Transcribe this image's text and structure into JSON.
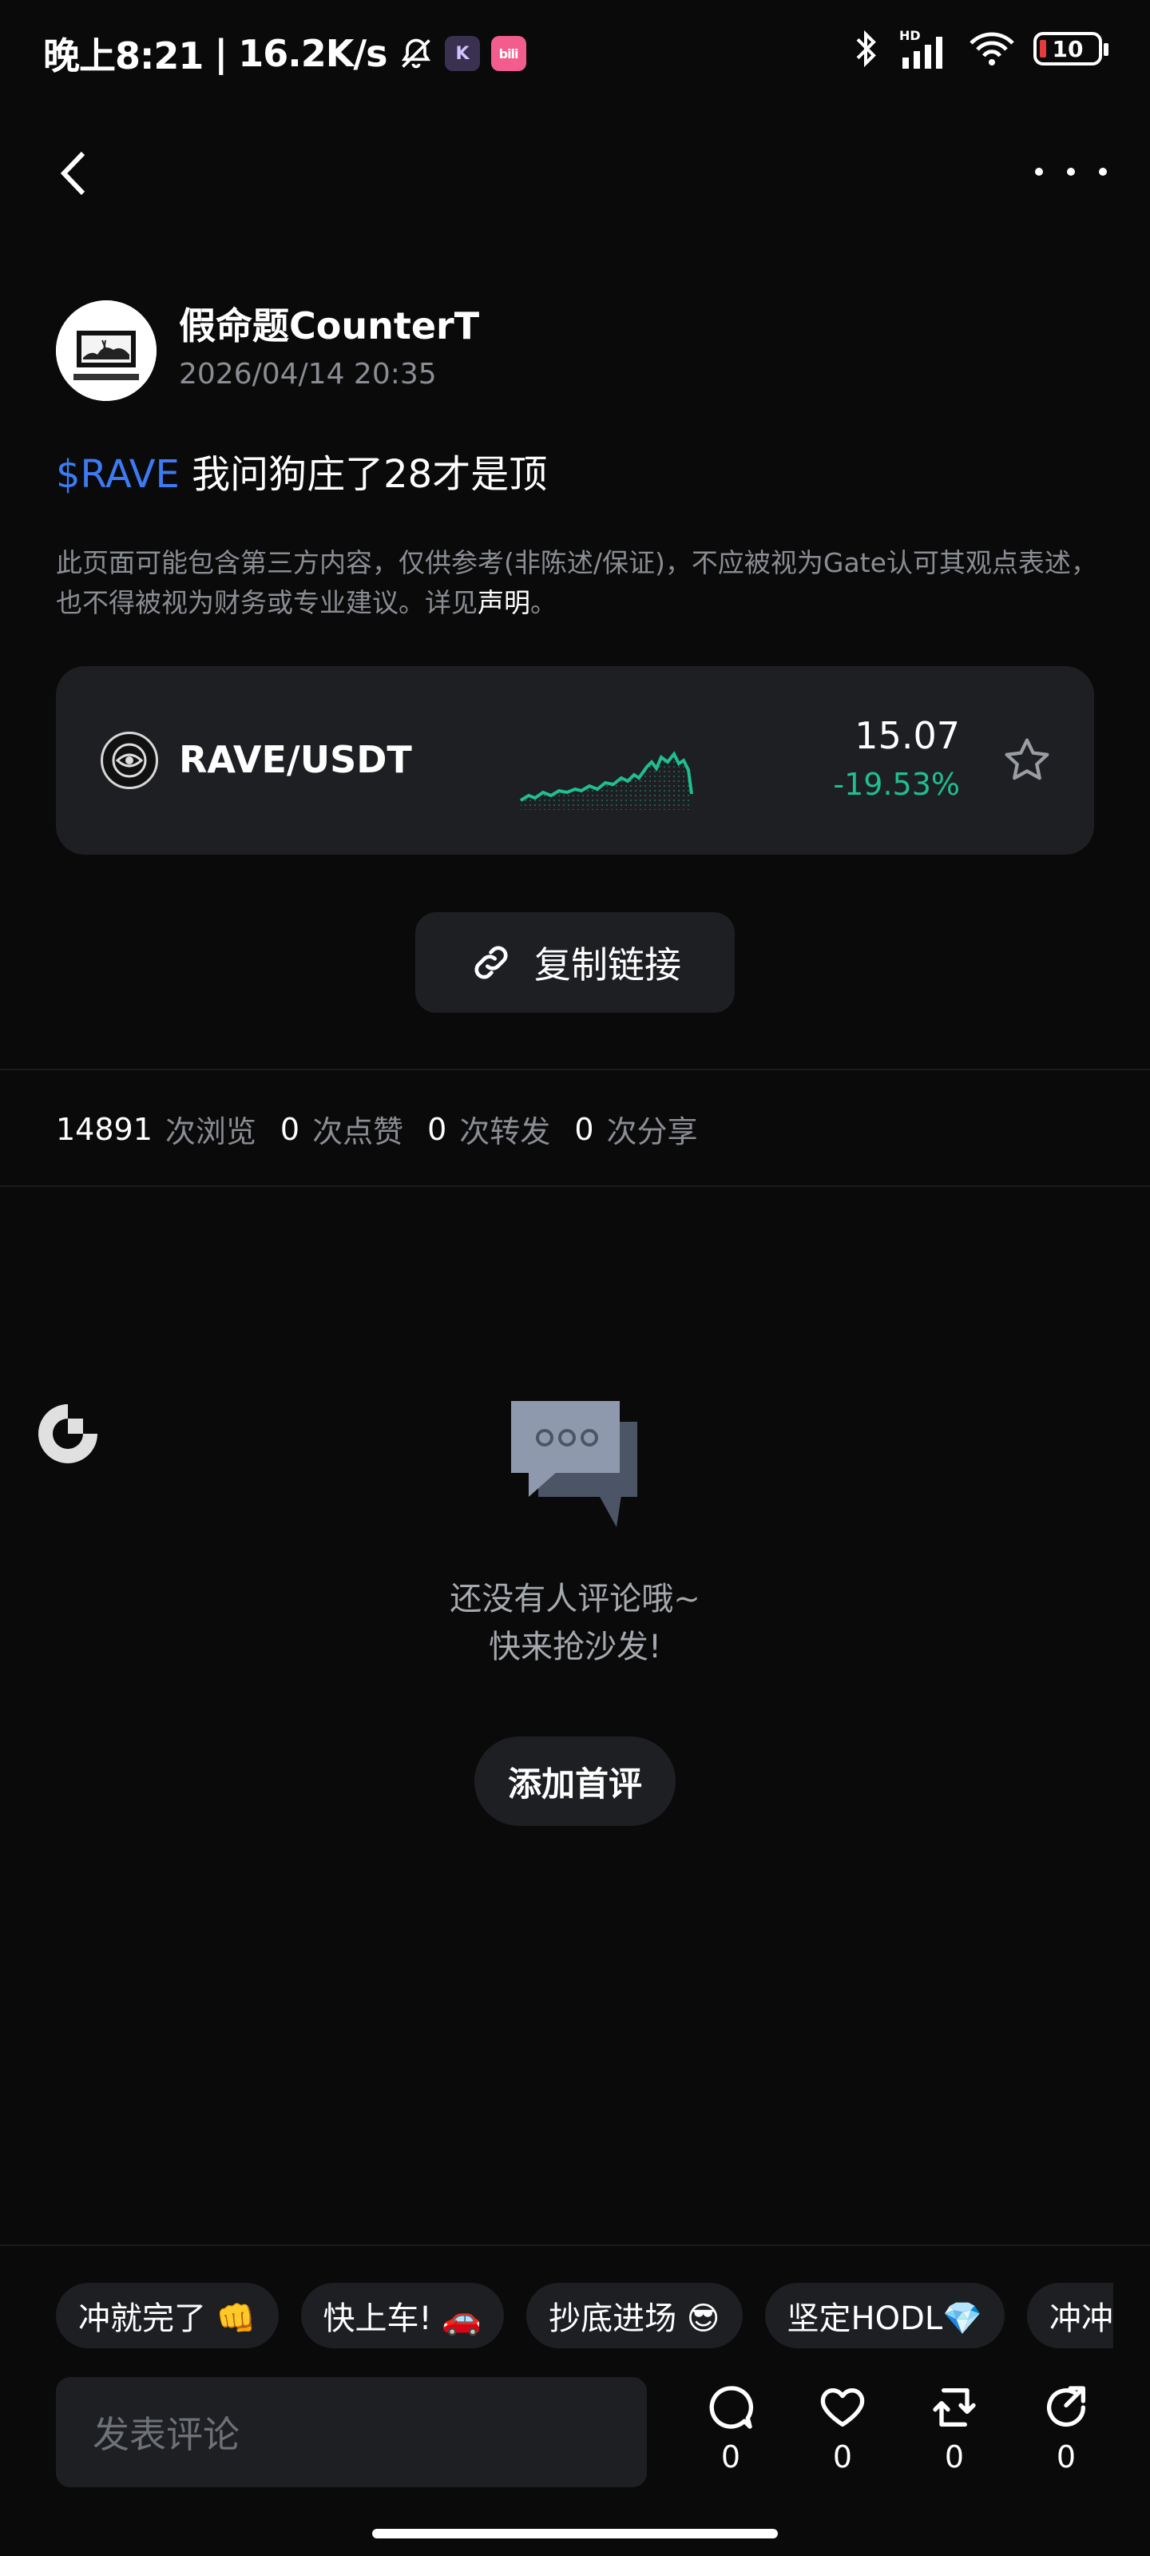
{
  "status_bar": {
    "time": "晚上8:21",
    "separator": "|",
    "speed": "16.2K/s",
    "app_badge_1": "K",
    "app_badge_2": "bili",
    "battery": "10"
  },
  "post": {
    "author": "假命题CounterT",
    "time": "2026/04/14 20:35",
    "tag": "$RAVE",
    "text": "我问狗庄了28才是顶",
    "disclaimer_text": "此页面可能包含第三方内容，仅供参考(非陈述/保证)，不应被视为Gate认可其观点表述，也不得被视为财务或专业建议。详见",
    "disclaimer_link": "声明",
    "disclaimer_end": "。"
  },
  "ticker": {
    "pair": "RAVE/USDT",
    "price": "15.07",
    "change": "-19.53%",
    "up_color": "#1fbf8f"
  },
  "copy_link_label": "复制链接",
  "stats": {
    "views": "14891",
    "views_label": "次浏览",
    "likes": "0",
    "likes_label": "次点赞",
    "reposts": "0",
    "reposts_label": "次转发",
    "shares": "0",
    "shares_label": "次分享"
  },
  "empty_state": {
    "line1": "还没有人评论哦~",
    "line2": "快来抢沙发!",
    "button": "添加首评"
  },
  "quick_replies": [
    "冲就完了 👊",
    "快上车! 🚗",
    "抄底进场 😎",
    "坚定HODL💎",
    "冲冲"
  ],
  "comment_input": {
    "placeholder": "发表评论"
  },
  "actions": {
    "comment_count": "0",
    "like_count": "0",
    "repost_count": "0",
    "share_count": "0"
  }
}
